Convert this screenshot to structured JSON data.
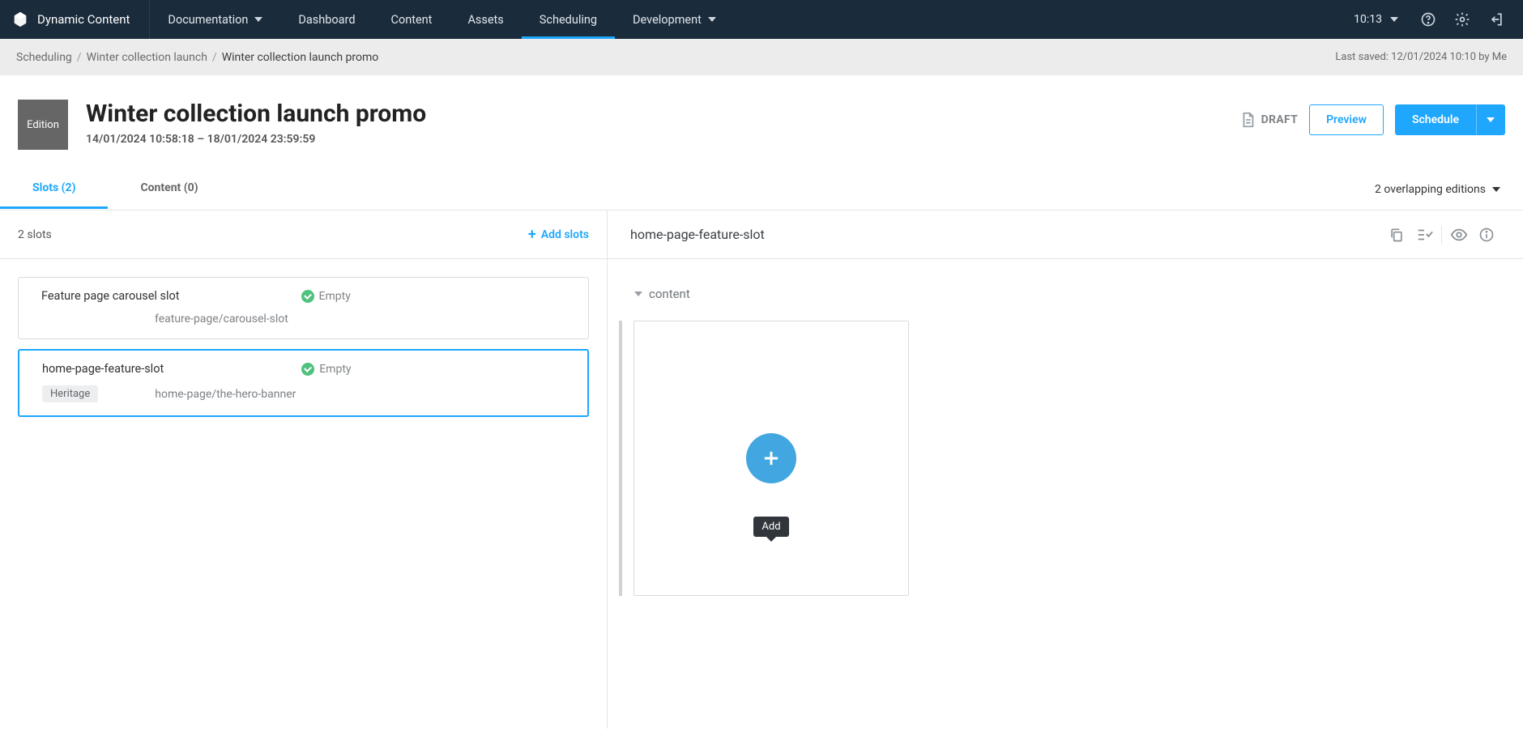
{
  "brand": "Dynamic Content",
  "nav": {
    "documentation": "Documentation",
    "dashboard": "Dashboard",
    "content": "Content",
    "assets": "Assets",
    "scheduling": "Scheduling",
    "development": "Development"
  },
  "clock": "10:13",
  "breadcrumb": {
    "a": "Scheduling",
    "b": "Winter collection launch",
    "c": "Winter collection launch promo",
    "saved": "Last saved: 12/01/2024 10:10 by Me"
  },
  "header": {
    "badge": "Edition",
    "title": "Winter collection launch promo",
    "dates": "14/01/2024 10:58:18  –  18/01/2024 23:59:59",
    "status": "DRAFT",
    "preview": "Preview",
    "schedule": "Schedule"
  },
  "tabs": {
    "slots": "Slots (2)",
    "content": "Content (0)",
    "overlap": "2 overlapping editions"
  },
  "left": {
    "count": "2 slots",
    "add": "Add slots",
    "cards": [
      {
        "name": "Feature page carousel slot",
        "status": "Empty",
        "path": "feature-page/carousel-slot",
        "chip": ""
      },
      {
        "name": "home-page-feature-slot",
        "status": "Empty",
        "path": "home-page/the-hero-banner",
        "chip": "Heritage"
      }
    ]
  },
  "right": {
    "title": "home-page-feature-slot",
    "section": "content",
    "tooltip": "Add"
  }
}
